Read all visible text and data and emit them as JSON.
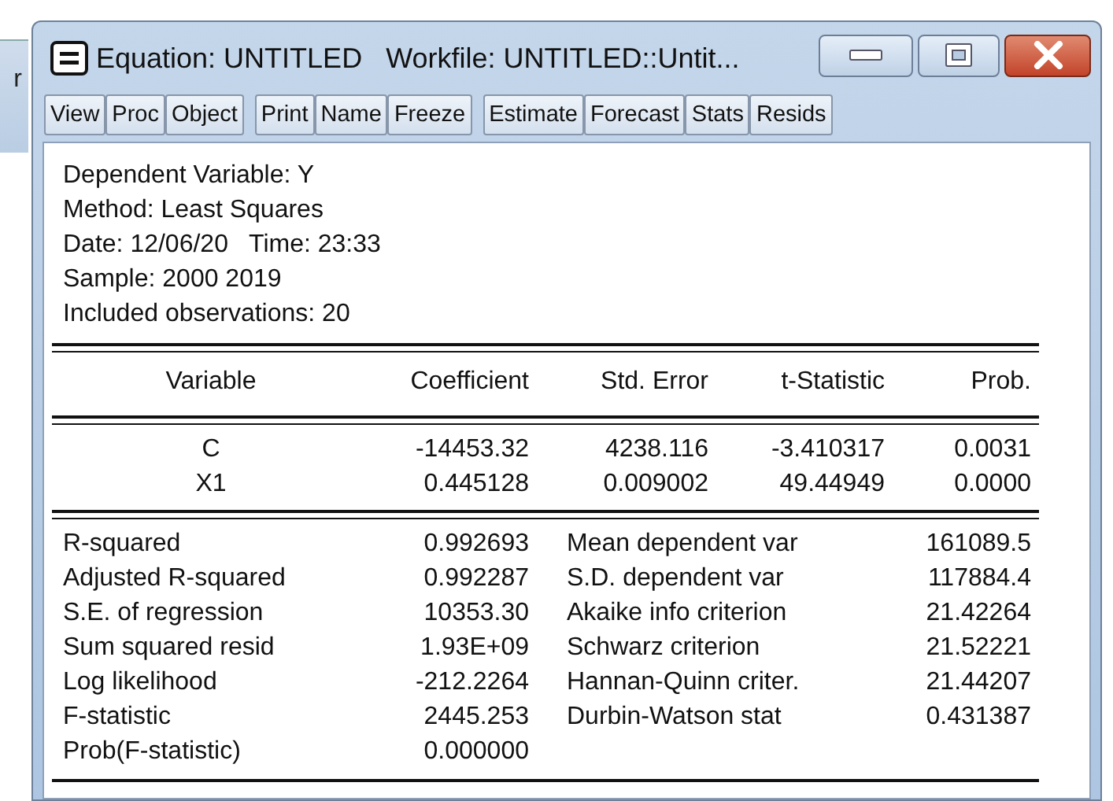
{
  "background_window": {
    "text": "r"
  },
  "window": {
    "title": "Equation: UNTITLED   Workfile: UNTITLED::Untit..."
  },
  "toolbar": [
    [
      "View",
      "Proc",
      "Object"
    ],
    [
      "Print",
      "Name",
      "Freeze"
    ],
    [
      "Estimate",
      "Forecast",
      "Stats",
      "Resids"
    ]
  ],
  "header_lines": [
    "Dependent Variable: Y",
    "Method: Least Squares",
    "Date: 12/06/20   Time: 23:33",
    "Sample: 2000 2019",
    "Included observations: 20"
  ],
  "table": {
    "columns": [
      "Variable",
      "Coefficient",
      "Std. Error",
      "t-Statistic",
      "Prob."
    ],
    "rows": [
      [
        "C",
        "-14453.32",
        "4238.116",
        "-3.410317",
        "0.0031"
      ],
      [
        "X1",
        "0.445128",
        "0.009002",
        "49.44949",
        "0.0000"
      ]
    ]
  },
  "statistics": [
    {
      "label": "R-squared",
      "value": "0.992693",
      "label_2": "Mean dependent var",
      "value_2": "161089.5"
    },
    {
      "label": "Adjusted R-squared",
      "value": "0.992287",
      "label_2": "S.D. dependent var",
      "value_2": "117884.4"
    },
    {
      "label": "S.E. of regression",
      "value": "10353.30",
      "label_2": "Akaike info criterion",
      "value_2": "21.42264"
    },
    {
      "label": "Sum squared resid",
      "value": "1.93E+09",
      "label_2": "Schwarz criterion",
      "value_2": "21.52221"
    },
    {
      "label": "Log likelihood",
      "value": "-212.2264",
      "label_2": "Hannan-Quinn criter.",
      "value_2": "21.44207"
    },
    {
      "label": "F-statistic",
      "value": "2445.253",
      "label_2": "Durbin-Watson stat",
      "value_2": "0.431387"
    },
    {
      "label": "Prob(F-statistic)",
      "value": "0.000000"
    }
  ]
}
